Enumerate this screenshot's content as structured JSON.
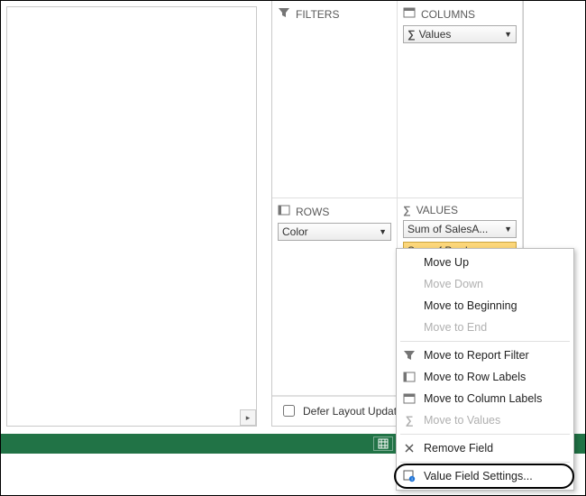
{
  "areas": {
    "filters": {
      "label": "FILTERS"
    },
    "columns": {
      "label": "COLUMNS",
      "items": [
        {
          "label": "Values",
          "sigma": true
        }
      ]
    },
    "rows": {
      "label": "ROWS",
      "items": [
        {
          "label": "Color",
          "sigma": false
        }
      ]
    },
    "values": {
      "label": "VALUES",
      "items": [
        {
          "label": "Sum of SalesA...",
          "sigma": false
        },
        {
          "label": "Sum of Produ...",
          "sigma": false,
          "selected": true
        }
      ]
    }
  },
  "defer": {
    "label": "Defer Layout Updat"
  },
  "menu": {
    "move_up": "Move Up",
    "move_down": "Move Down",
    "move_beginning": "Move to Beginning",
    "move_end": "Move to End",
    "to_report_filter": "Move to Report Filter",
    "to_row_labels": "Move to Row Labels",
    "to_column_labels": "Move to Column Labels",
    "to_values": "Move to Values",
    "remove_field": "Remove Field",
    "value_field_settings": "Value Field Settings..."
  }
}
